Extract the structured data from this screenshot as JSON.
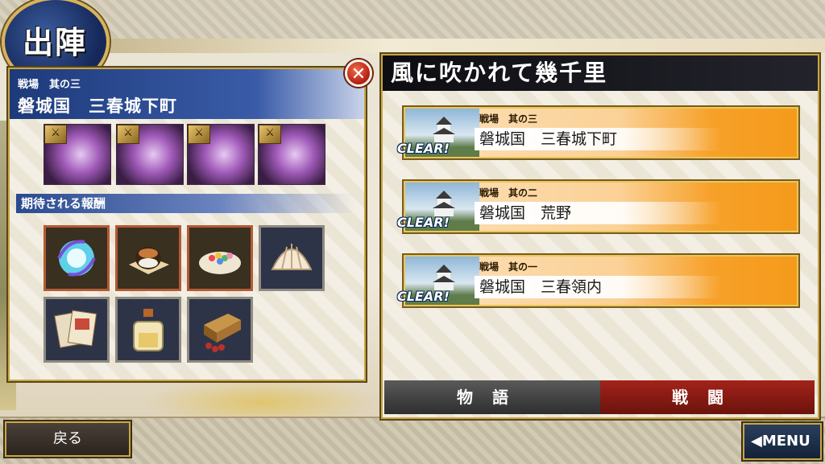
{
  "header": {
    "emblem_label": "出陣"
  },
  "left_panel": {
    "subtitle": "戦場　其の三",
    "title": "磐城国　三春城下町",
    "close_symbol": "✕",
    "enemies": [
      {
        "name": "enemy-1",
        "weapon_icon": "tanto"
      },
      {
        "name": "enemy-2",
        "weapon_icon": "wakizashi"
      },
      {
        "name": "enemy-3",
        "weapon_icon": "uchigatana"
      },
      {
        "name": "enemy-4",
        "weapon_icon": "spear"
      }
    ],
    "reward_heading": "期待される報酬",
    "rewards": [
      {
        "name": "spirit-orb"
      },
      {
        "name": "manju"
      },
      {
        "name": "konpeito"
      },
      {
        "name": "shell"
      },
      {
        "name": "tickets"
      },
      {
        "name": "sake-bottle"
      },
      {
        "name": "wooden-box"
      }
    ]
  },
  "right_panel": {
    "title": "風に吹かれて幾千里",
    "stages": [
      {
        "subtitle": "戦場　其の三",
        "name": "磐城国　三春城下町",
        "status": "CLEAR!"
      },
      {
        "subtitle": "戦場　其の二",
        "name": "磐城国　荒野",
        "status": "CLEAR!"
      },
      {
        "subtitle": "戦場　其の一",
        "name": "磐城国　三春領内",
        "status": "CLEAR!"
      }
    ],
    "tabs": {
      "story": "物語",
      "battle": "戦闘"
    }
  },
  "footer": {
    "back_label": "戻る",
    "menu_label": "◀MENU"
  },
  "colors": {
    "accent_gold": "#c9a646",
    "panel_blue": "#1d3a7a",
    "stage_orange": "#f59a1a",
    "battle_red": "#a3231a"
  }
}
